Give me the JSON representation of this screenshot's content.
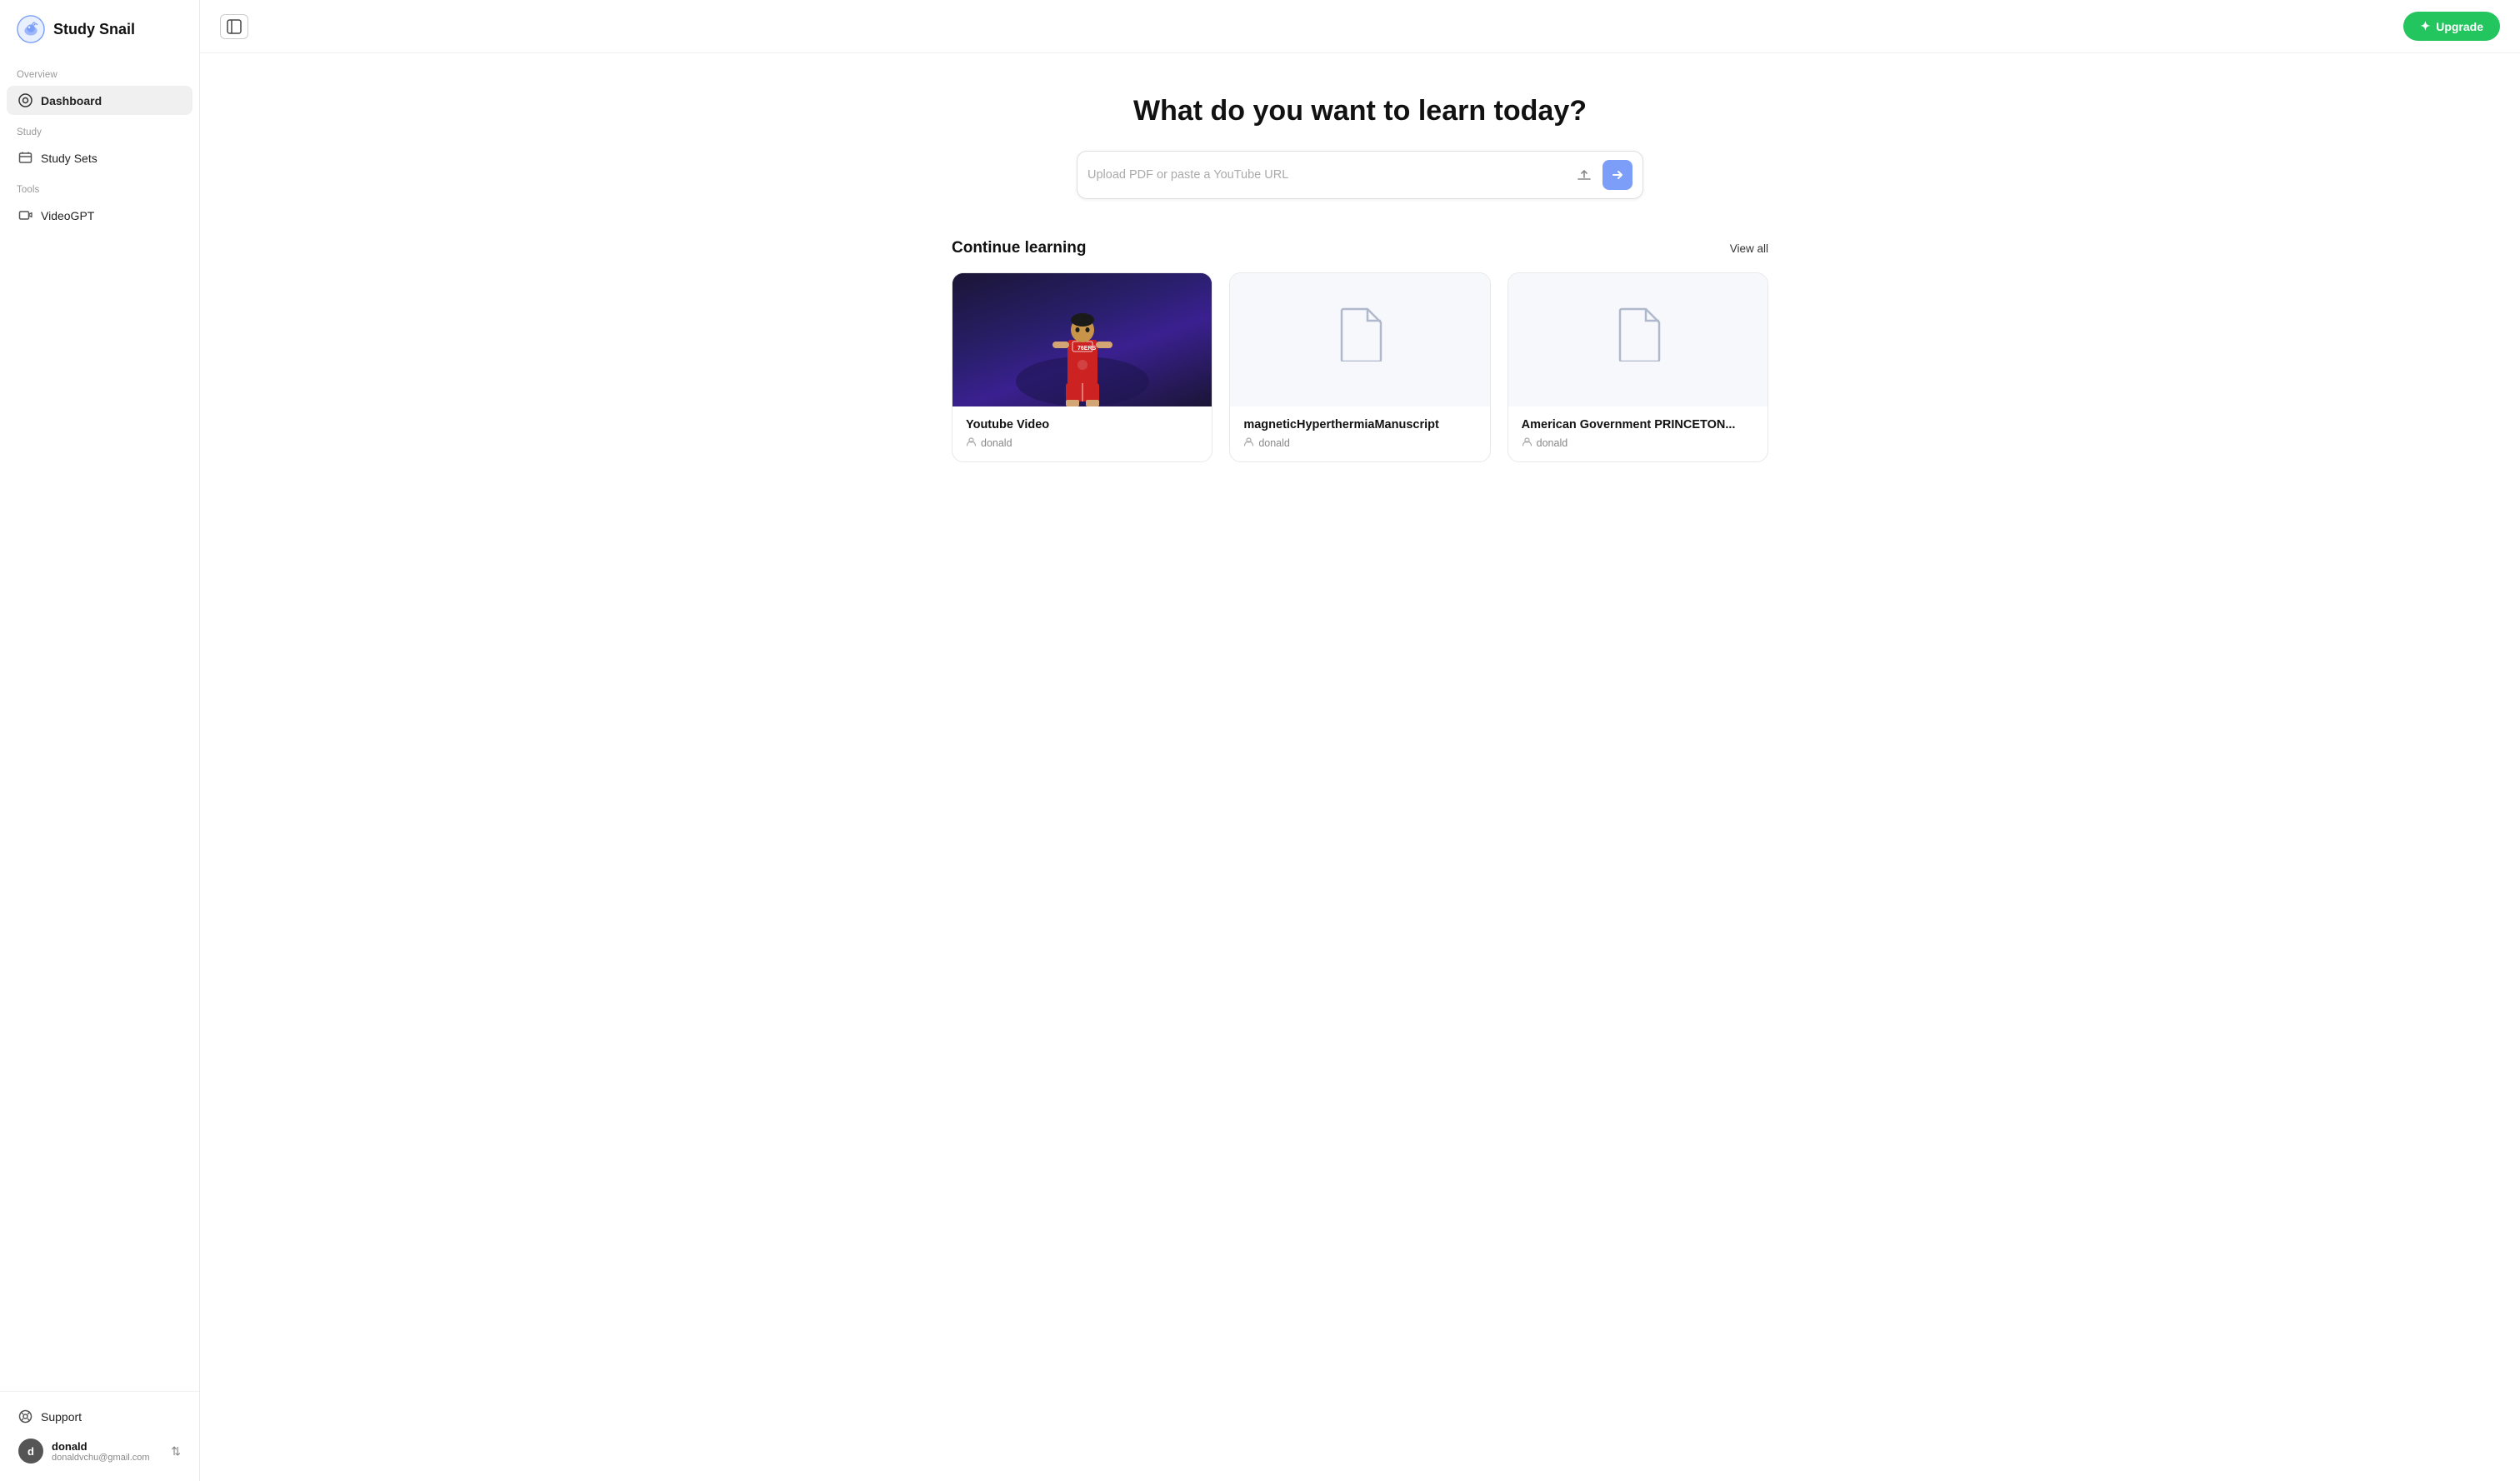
{
  "app": {
    "name": "Study Snail"
  },
  "sidebar": {
    "overview_label": "Overview",
    "dashboard_label": "Dashboard",
    "study_label": "Study",
    "study_sets_label": "Study Sets",
    "tools_label": "Tools",
    "videogpt_label": "VideoGPT",
    "support_label": "Support"
  },
  "user": {
    "name": "donald",
    "email": "donaldvchu@gmail.com",
    "avatar_letter": "d"
  },
  "topbar": {
    "upgrade_label": "Upgrade"
  },
  "main": {
    "hero_title": "What do you want to learn today?",
    "search_placeholder": "Upload PDF or paste a YouTube URL",
    "continue_learning_label": "Continue learning",
    "view_all_label": "View all"
  },
  "cards": [
    {
      "id": 1,
      "title": "Youtube Video",
      "author": "donald",
      "has_image": true,
      "image_type": "basketball_player"
    },
    {
      "id": 2,
      "title": "magneticHyperthermiaManuscript",
      "author": "donald",
      "has_image": false,
      "image_type": "document"
    },
    {
      "id": 3,
      "title": "American Government PRINCETON...",
      "author": "donald",
      "has_image": false,
      "image_type": "document"
    }
  ]
}
